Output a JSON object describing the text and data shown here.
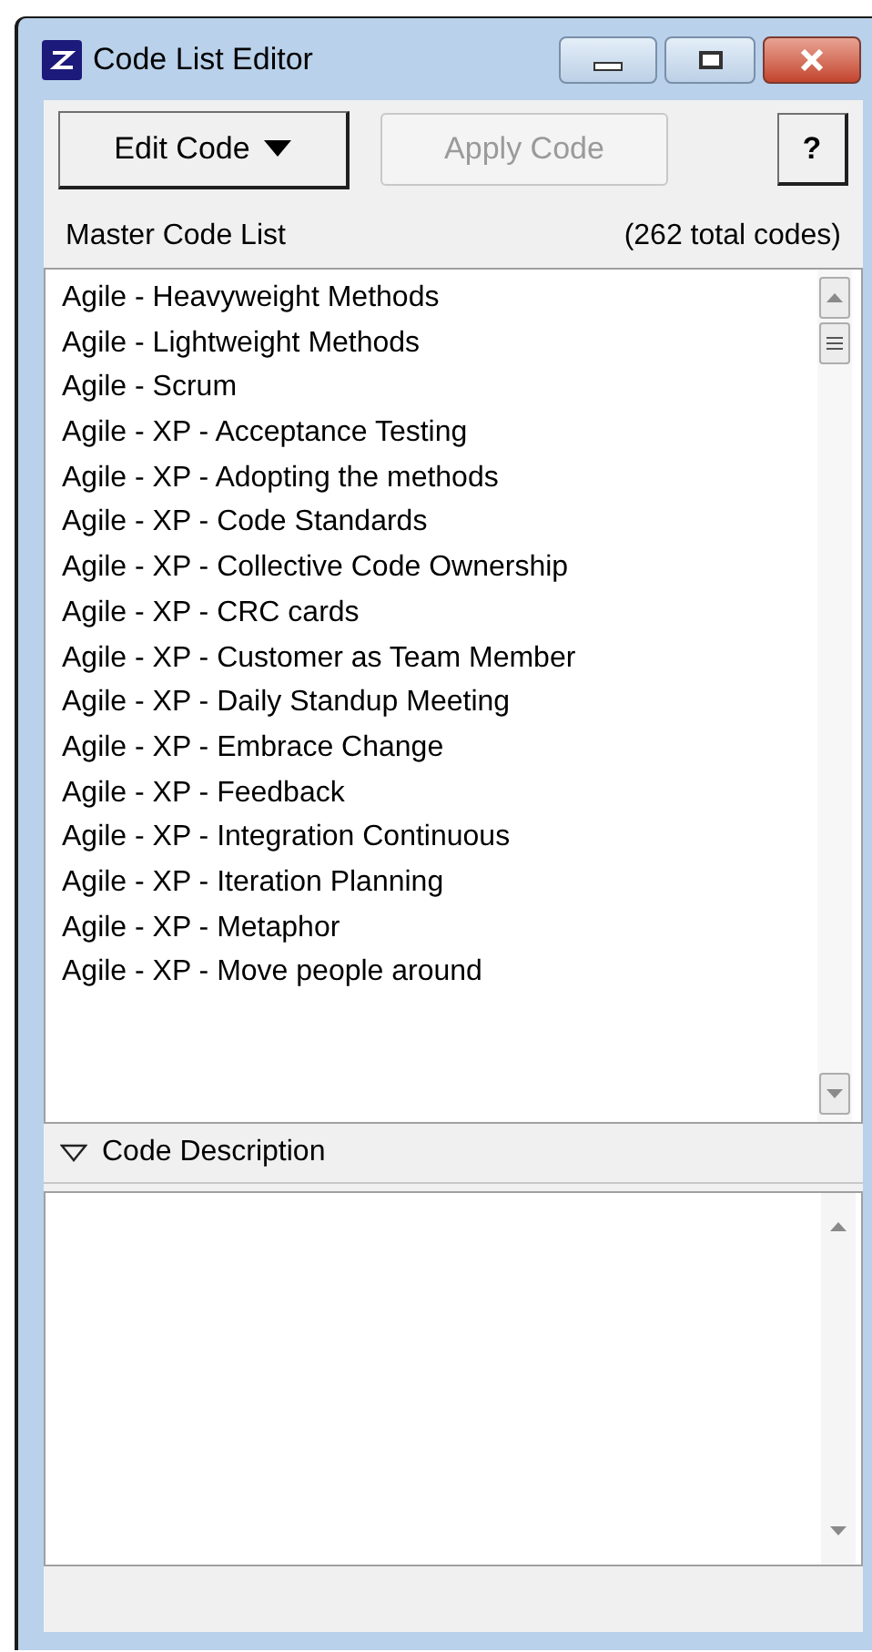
{
  "window": {
    "title": "Code List Editor"
  },
  "toolbar": {
    "edit_button": {
      "label": "Edit Code",
      "disabled": false
    },
    "apply_button": {
      "label": "Apply Code",
      "disabled": true
    },
    "help_button": {
      "label": "?"
    }
  },
  "list_header": {
    "title": "Master Code List",
    "count": "(262 total codes)"
  },
  "codes": [
    {
      "label": "Agile - Heavyweight Methods",
      "selected": false
    },
    {
      "label": "Agile - Lightweight Methods",
      "selected": false
    },
    {
      "label": "Agile - Scrum",
      "selected": false
    },
    {
      "label": "Agile - XP - Acceptance Testing",
      "selected": false
    },
    {
      "label": "Agile - XP - Adopting the methods",
      "selected": false
    },
    {
      "label": "Agile - XP - Code Standards",
      "selected": false
    },
    {
      "label": "Agile - XP - Collective Code Ownership",
      "selected": false
    },
    {
      "label": "Agile - XP - CRC cards",
      "selected": false
    },
    {
      "label": "Agile - XP - Customer as Team Member",
      "selected": false
    },
    {
      "label": "Agile - XP - Daily Standup Meeting",
      "selected": false
    },
    {
      "label": "Agile - XP - Embrace Change",
      "selected": false
    },
    {
      "label": "Agile - XP - Feedback",
      "selected": false
    },
    {
      "label": "Agile - XP - Integration Continuous",
      "selected": false
    },
    {
      "label": "Agile - XP - Iteration Planning",
      "selected": false
    },
    {
      "label": "Agile - XP - Metaphor",
      "selected": false
    },
    {
      "label": "Agile - XP - Move people around",
      "selected": false
    }
  ],
  "description": {
    "title": "Code Description",
    "expanded": true
  }
}
